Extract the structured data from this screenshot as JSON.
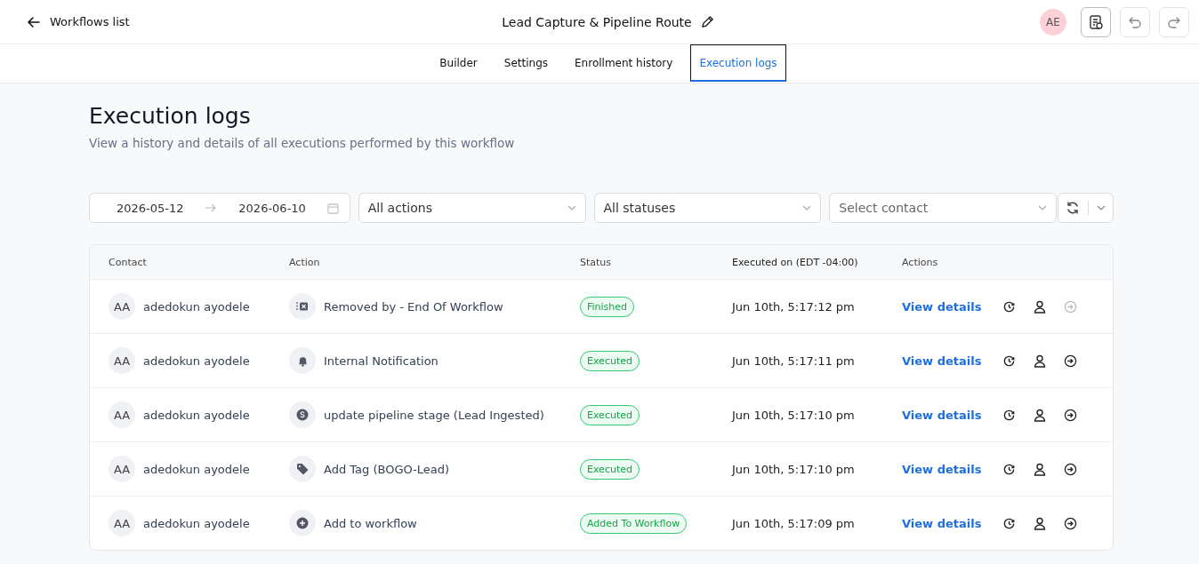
{
  "header": {
    "back_label": "Workflows list",
    "title": "Lead Capture & Pipeline Route",
    "avatar": "AE"
  },
  "tabs": [
    {
      "label": "Builder",
      "selected": false
    },
    {
      "label": "Settings",
      "selected": false
    },
    {
      "label": "Enrollment history",
      "selected": false
    },
    {
      "label": "Execution logs",
      "selected": true
    }
  ],
  "page": {
    "title": "Execution logs",
    "subtitle": "View a history and details of all executions performed by this workflow"
  },
  "filters": {
    "date_from": "2026-05-12",
    "date_to": "2026-06-10",
    "action": "All actions",
    "status": "All statuses",
    "contact_placeholder": "Select contact"
  },
  "table": {
    "columns": [
      "Contact",
      "Action",
      "Status",
      "Executed on (EDT -04:00)",
      "Actions"
    ],
    "rows": [
      {
        "initials": "AA",
        "contact": "adedokun ayodele",
        "kind": "remove",
        "action": "Removed by - End Of Workflow",
        "status": "Finished",
        "executed_on": "Jun 10th, 5:17:12 pm",
        "link": "View details",
        "exit_disabled": true
      },
      {
        "initials": "AA",
        "contact": "adedokun ayodele",
        "kind": "bell",
        "action": "Internal Notification",
        "status": "Executed",
        "executed_on": "Jun 10th, 5:17:11 pm",
        "link": "View details",
        "exit_disabled": false
      },
      {
        "initials": "AA",
        "contact": "adedokun ayodele",
        "kind": "dollar",
        "action": "update pipeline stage (Lead Ingested)",
        "status": "Executed",
        "executed_on": "Jun 10th, 5:17:10 pm",
        "link": "View details",
        "exit_disabled": false
      },
      {
        "initials": "AA",
        "contact": "adedokun ayodele",
        "kind": "tag",
        "action": "Add Tag (BOGO-Lead)",
        "status": "Executed",
        "executed_on": "Jun 10th, 5:17:10 pm",
        "link": "View details",
        "exit_disabled": false
      },
      {
        "initials": "AA",
        "contact": "adedokun ayodele",
        "kind": "plus",
        "action": "Add to workflow",
        "status": "Added To Workflow",
        "executed_on": "Jun 10th, 5:17:09 pm",
        "link": "View details",
        "exit_disabled": false
      }
    ]
  }
}
